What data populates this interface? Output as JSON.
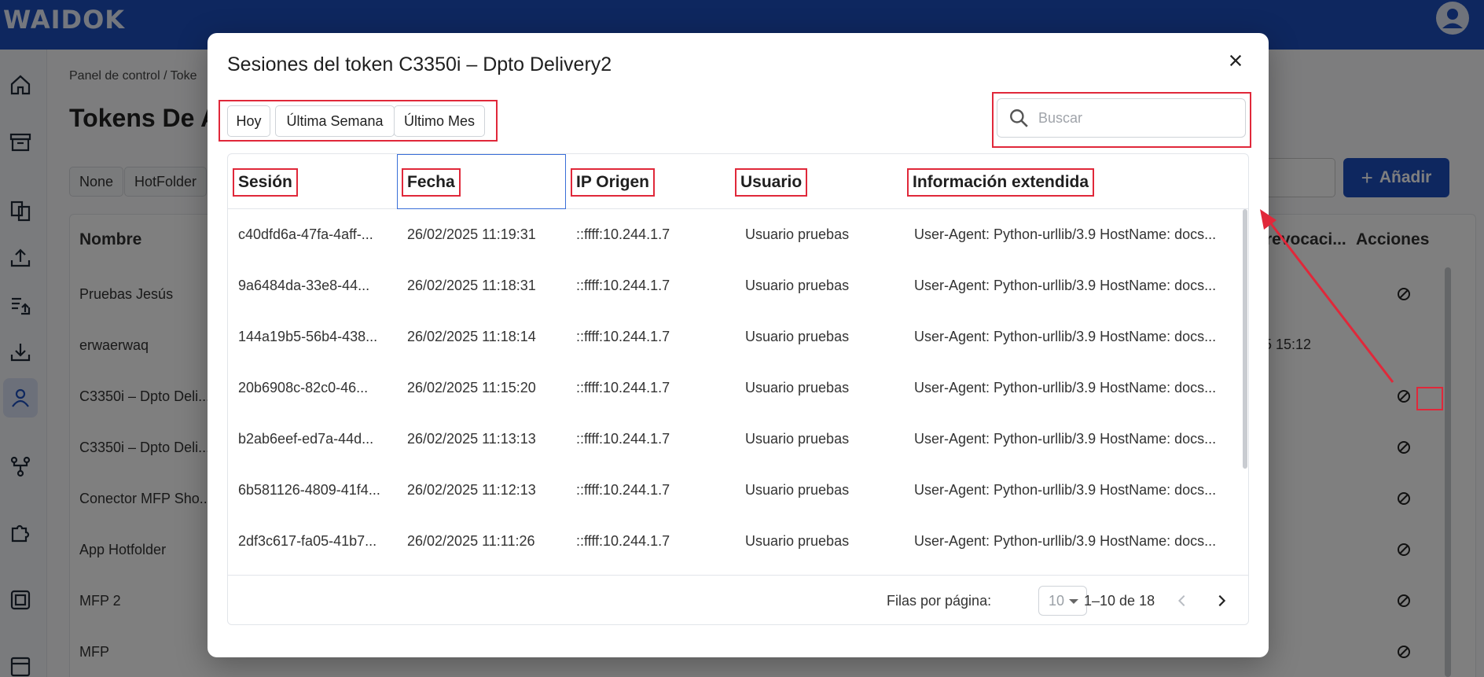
{
  "app": {
    "logo_text": "WAIDOK"
  },
  "background": {
    "breadcrumb": "Panel de control  /  Toke",
    "page_title": "Tokens De A",
    "filter_chips": [
      "None",
      "HotFolder"
    ],
    "add_button_label": "Añadir",
    "columns": {
      "name": "Nombre",
      "revocation": "revocaci...",
      "actions": "Acciones"
    },
    "rows": [
      "Pruebas Jesús",
      "erwaerwaq",
      "C3350i – Dpto Deli...",
      "C3350i – Dpto Deli...",
      "Conector MFP Sho...",
      "App Hotfolder",
      "MFP 2",
      "MFP"
    ],
    "date_fragment": "5 15:12"
  },
  "modal": {
    "title": "Sesiones del token C3350i – Dpto Delivery2",
    "close_icon": "close-icon",
    "range_buttons": [
      "Hoy",
      "Última Semana",
      "Último Mes"
    ],
    "search": {
      "placeholder": "Buscar",
      "value": ""
    },
    "columns": [
      "Sesión",
      "Fecha",
      "IP Origen",
      "Usuario",
      "Información extendida"
    ],
    "rows": [
      {
        "session": "c40dfd6a-47fa-4aff-...",
        "date": "26/02/2025 11:19:31",
        "ip": "::ffff:10.244.1.7",
        "user": "Usuario pruebas",
        "info": "User-Agent: Python-urllib/3.9 HostName: docs..."
      },
      {
        "session": "9a6484da-33e8-44...",
        "date": "26/02/2025 11:18:31",
        "ip": "::ffff:10.244.1.7",
        "user": "Usuario pruebas",
        "info": "User-Agent: Python-urllib/3.9 HostName: docs..."
      },
      {
        "session": "144a19b5-56b4-438...",
        "date": "26/02/2025 11:18:14",
        "ip": "::ffff:10.244.1.7",
        "user": "Usuario pruebas",
        "info": "User-Agent: Python-urllib/3.9 HostName: docs..."
      },
      {
        "session": "20b6908c-82c0-46...",
        "date": "26/02/2025 11:15:20",
        "ip": "::ffff:10.244.1.7",
        "user": "Usuario pruebas",
        "info": "User-Agent: Python-urllib/3.9 HostName: docs..."
      },
      {
        "session": "b2ab6eef-ed7a-44d...",
        "date": "26/02/2025 11:13:13",
        "ip": "::ffff:10.244.1.7",
        "user": "Usuario pruebas",
        "info": "User-Agent: Python-urllib/3.9 HostName: docs..."
      },
      {
        "session": "6b581126-4809-41f4...",
        "date": "26/02/2025 11:12:13",
        "ip": "::ffff:10.244.1.7",
        "user": "Usuario pruebas",
        "info": "User-Agent: Python-urllib/3.9 HostName: docs..."
      },
      {
        "session": "2df3c617-fa05-41b7...",
        "date": "26/02/2025 11:11:26",
        "ip": "::ffff:10.244.1.7",
        "user": "Usuario pruebas",
        "info": "User-Agent: Python-urllib/3.9 HostName: docs..."
      }
    ],
    "pagination": {
      "rows_per_page_label": "Filas por página:",
      "rows_per_page_value": "10",
      "range": "1–10 de 18"
    }
  },
  "colors": {
    "brand": "#1d4fbf",
    "annotation": "#e0283a"
  }
}
